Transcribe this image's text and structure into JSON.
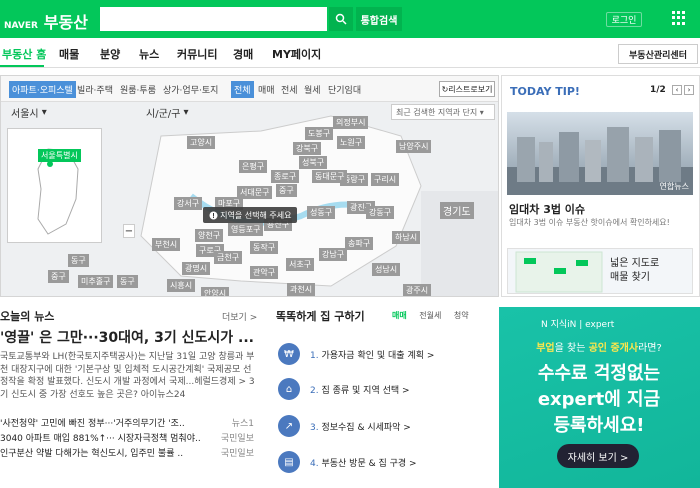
{
  "header": {
    "logo_naver": "NAVER",
    "logo_service": "부동산",
    "search_placeholder": "",
    "search_button": "통합검색",
    "login": "로그인"
  },
  "nav": {
    "items": [
      "부동산 홈",
      "매물",
      "분양",
      "뉴스",
      "커뮤니티",
      "경매",
      "MY페이지"
    ],
    "right_button": "부동산관리센터"
  },
  "map": {
    "filter_tabs": [
      "아파트·오피스텔",
      "빌라·주택",
      "원룸·투룸",
      "상가·업무·토지",
      "전체",
      "매매",
      "전세",
      "월세",
      "단기임대"
    ],
    "relist_button": "리스트로보기",
    "city": "서울시",
    "district": "시/군/구",
    "recent_placeholder": "최근 검색한 지역과 단지",
    "mini_label": "서울특별시",
    "notice": "지역을 선택해 주세요",
    "labels": [
      "고양시",
      "도봉구",
      "노원구",
      "의정부시",
      "남양주시",
      "은평구",
      "성북구",
      "강북구",
      "중랑구",
      "구리시",
      "서대문구",
      "종로구",
      "동대문구",
      "광진구",
      "강서구",
      "마포구",
      "중구",
      "성동구",
      "강동구",
      "양천구",
      "영등포구",
      "용산구",
      "송파구",
      "하남시",
      "구로구",
      "동작구",
      "서초구",
      "강남구",
      "부천시",
      "금천구",
      "관악구",
      "경기도",
      "광명시",
      "시흥시",
      "과천시",
      "성남시",
      "광주시",
      "안양시",
      "중구",
      "동구",
      "미추홀구",
      "동구"
    ]
  },
  "today": {
    "title": "TODAY TIP!",
    "page": "1/2",
    "item_title": "임대차 3법 이슈",
    "item_desc": "임대차 3법 이슈 부동산 핫이슈에서 확인하세요!",
    "photo_credit": "연합뉴스",
    "map_card_line1": "넓은 지도로",
    "map_card_line2": "매물 찾기"
  },
  "news": {
    "title": "오늘의 뉴스",
    "more": "더보기 >",
    "headline": "'영끌' 은 그만···30대여, 3기 신도시가 ...",
    "body": "국토교통부와 LH(한국토지주택공사)는 지난달 31일 고양 창릉과 부천 대장지구에 대한 '기본구상 및 입체적 도시공간계획' 국제공모 선정작을 확정 발표했다. 신도시 개발 과정에서 국제...헤럴드경제 > 3기 신도시 중 가장 선호도 높은 곳은? 아이뉴스24",
    "list": [
      {
        "text": "'사전청약' 고민에 빠진 정부···'거주의무기간 '조..",
        "src": "뉴스1"
      },
      {
        "text": "3040 아파트 매입 881%↑··· 시장자극정책 멈춰야..",
        "src": "국민일보"
      },
      {
        "text": "인구분산 약발 다해가는 혁신도시, 입주민 불률 ..",
        "src": "국민일보"
      }
    ]
  },
  "guide": {
    "title": "똑똑하게 집 구하기",
    "tabs": [
      "매매",
      "전월세",
      "청약"
    ],
    "steps": [
      {
        "num": "1.",
        "text": "가용자금 확인 및 대출 계획 >"
      },
      {
        "num": "2.",
        "text": "집 종류 및 지역 선택 >"
      },
      {
        "num": "3.",
        "text": "정보수집 & 시세파악 >"
      },
      {
        "num": "4.",
        "text": "부동산 방문 & 집 구경 >"
      }
    ]
  },
  "ad": {
    "brand": "N 지식iN | expert",
    "line1_pre": "부업",
    "line1_mid": "을 찾는 ",
    "line1_hl": "공인 중개사",
    "line1_post": "라면?",
    "line2": "수수료 걱정없는",
    "line3": "expert에 지금",
    "line4": "등록하세요!",
    "cta": "자세히 보기 >"
  },
  "colors": {
    "brand": "#03c75a",
    "accent": "#3b6eb8",
    "ad_bg": "#19c2a8"
  }
}
